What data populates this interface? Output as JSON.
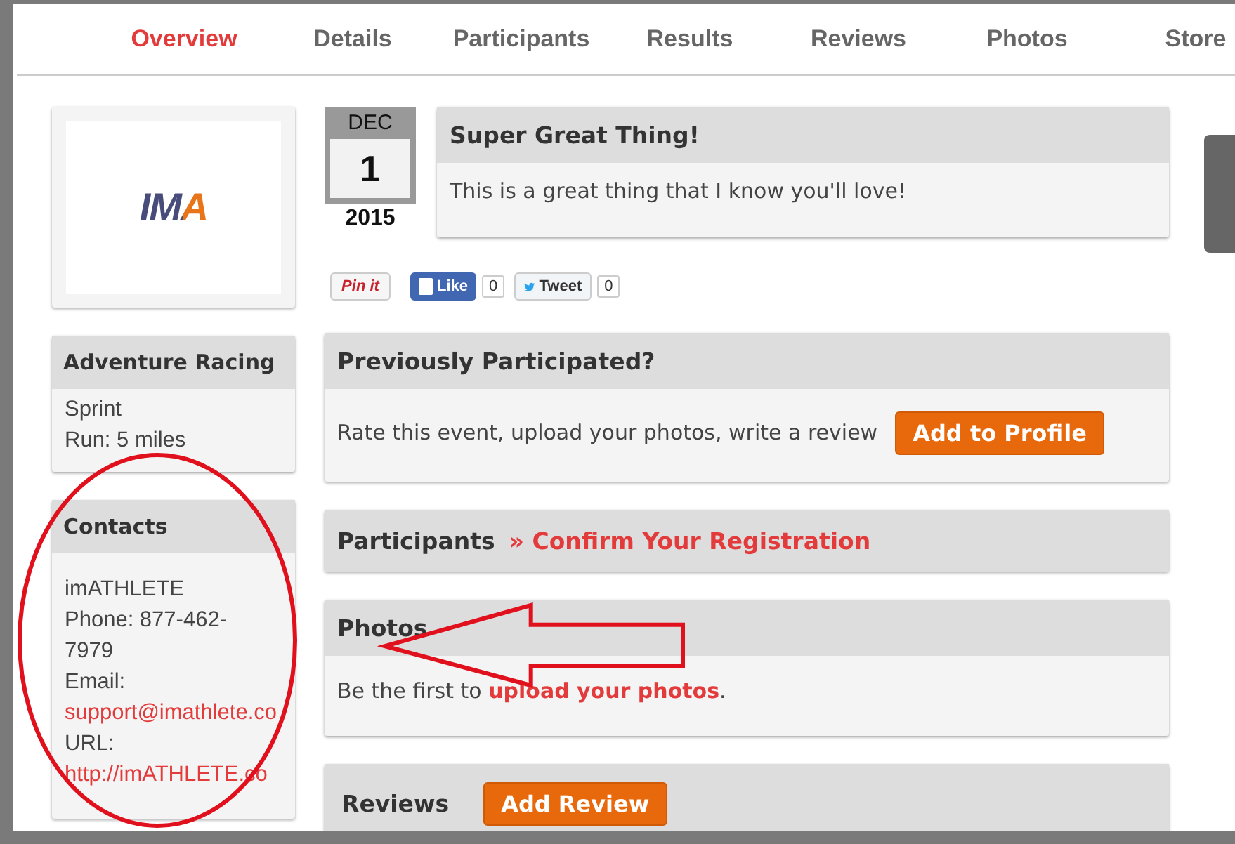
{
  "nav": {
    "tabs": [
      {
        "label": "Overview",
        "selected": true
      },
      {
        "label": "Details",
        "selected": false
      },
      {
        "label": "Participants",
        "selected": false
      },
      {
        "label": "Results",
        "selected": false
      },
      {
        "label": "Reviews",
        "selected": false
      },
      {
        "label": "Photos",
        "selected": false
      },
      {
        "label": "Store",
        "selected": false
      }
    ]
  },
  "logo": {
    "text": "IMA"
  },
  "date": {
    "month": "DEC",
    "day": "1",
    "year": "2015"
  },
  "event": {
    "title": "Super Great Thing!",
    "description": "This is a great thing that I know you'll love!"
  },
  "share": [
    {
      "kind": "pin",
      "label": "Pin it"
    },
    {
      "kind": "like",
      "label": "Like",
      "count": "0"
    },
    {
      "kind": "tweet",
      "label": "Tweet",
      "count": "0"
    }
  ],
  "category": {
    "title": "Adventure Racing",
    "lines": [
      "Sprint",
      "Run: 5 miles"
    ]
  },
  "contacts": {
    "title": "Contacts",
    "items": [
      {
        "kind": "text",
        "text": "imATHLETE"
      },
      {
        "kind": "text",
        "text": "Phone: 877-462-7979"
      },
      {
        "kind": "text",
        "text": "Email:"
      },
      {
        "kind": "link",
        "text": "support@imathlete.co"
      },
      {
        "kind": "text",
        "text": "URL:"
      },
      {
        "kind": "link",
        "text": "http://imATHLETE.co"
      }
    ]
  },
  "sections": [
    {
      "kind": "body-button",
      "title": "Previously Participated?",
      "text": "Rate this event, upload your photos, write a review",
      "button": "Add to Profile"
    },
    {
      "kind": "header-link",
      "title": "Participants",
      "link": "» Confirm Your Registration"
    },
    {
      "kind": "body-link",
      "title": "Photos",
      "before": "Be the first to ",
      "link": "upload your photos",
      "after": "."
    },
    {
      "kind": "header-button",
      "title": "Reviews",
      "button": "Add Review"
    }
  ],
  "annotations": [
    {
      "kind": "ellipse"
    },
    {
      "kind": "arrow"
    }
  ]
}
